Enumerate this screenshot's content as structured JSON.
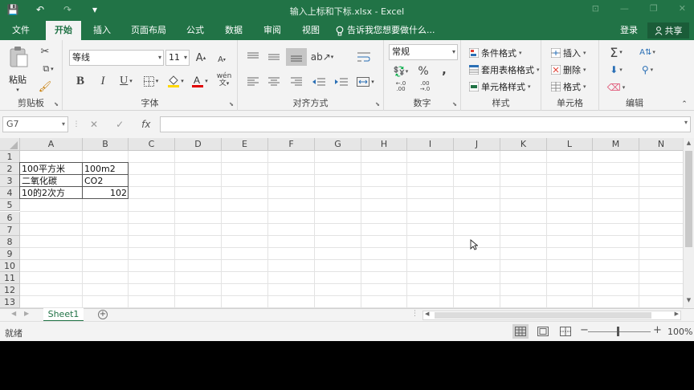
{
  "window": {
    "title": "输入上标和下标.xlsx - Excel",
    "min": "—",
    "restore": "❐",
    "close": "✕",
    "ribbon_toggle": "⊡"
  },
  "qat": {
    "save": "💾",
    "undo": "↶",
    "redo": "↷",
    "customize": "▾"
  },
  "tabs": [
    "文件",
    "开始",
    "插入",
    "页面布局",
    "公式",
    "数据",
    "审阅",
    "视图"
  ],
  "active_tab": "开始",
  "tellme": "告诉我您想要做什么...",
  "login": "登录",
  "share": "共享",
  "ribbon": {
    "clipboard": {
      "label": "剪贴板",
      "paste": "粘贴"
    },
    "font": {
      "label": "字体",
      "font_name": "等线",
      "font_size": "11",
      "bold": "B",
      "italic": "I",
      "underline": "U",
      "grow": "A",
      "shrink": "A",
      "phonetic": "wén"
    },
    "alignment": {
      "label": "对齐方式"
    },
    "number": {
      "label": "数字",
      "format": "常规",
      "percent": "%",
      "comma": ",",
      "inc_decimal": ".0←.00",
      "dec_decimal": ".00→.0"
    },
    "styles": {
      "label": "样式",
      "conditional": "条件格式",
      "table": "套用表格格式",
      "cell_styles": "单元格样式"
    },
    "cells": {
      "label": "单元格",
      "insert": "插入",
      "delete": "删除",
      "format": "格式"
    },
    "editing": {
      "label": "编辑"
    }
  },
  "formula_bar": {
    "name_box": "G7",
    "cancel": "✕",
    "confirm": "✓",
    "fx": "fx",
    "value": ""
  },
  "columns": [
    "A",
    "B",
    "C",
    "D",
    "E",
    "F",
    "G",
    "H",
    "I",
    "J",
    "K",
    "L",
    "M",
    "N"
  ],
  "rows": [
    "1",
    "2",
    "3",
    "4",
    "5",
    "6",
    "7",
    "8",
    "9",
    "10",
    "11",
    "12",
    "13"
  ],
  "cells": {
    "A2": "100平方米",
    "B2": "100m2",
    "A3": "二氧化碳",
    "B3": "CO2",
    "A4": "10的2次方",
    "B4": "102"
  },
  "sheets": [
    "Sheet1"
  ],
  "status": {
    "ready": "就绪",
    "zoom": "100%"
  }
}
